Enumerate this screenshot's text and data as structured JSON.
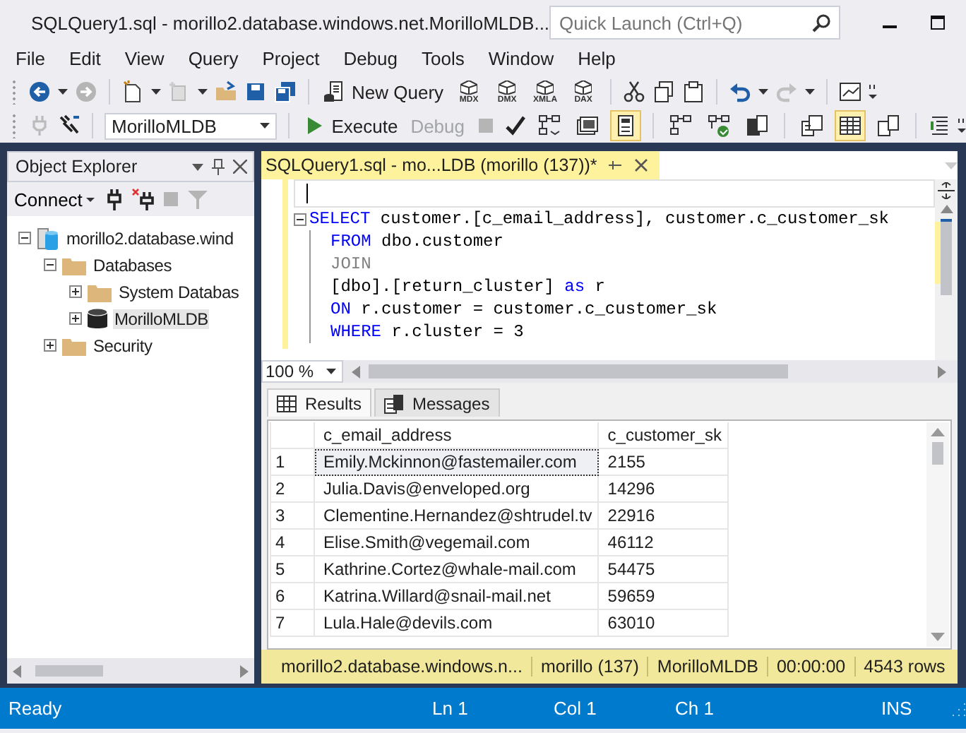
{
  "window": {
    "title": "SQLQuery1.sql - morillo2.database.windows.net.MorilloMLDB...",
    "quick_launch": {
      "placeholder": "Quick Launch (Ctrl+Q)"
    }
  },
  "menu": [
    "File",
    "Edit",
    "View",
    "Query",
    "Project",
    "Debug",
    "Tools",
    "Window",
    "Help"
  ],
  "toolbar_1": {
    "new_query": "New Query",
    "query_types": [
      "MDX",
      "DMX",
      "XMLA",
      "DAX"
    ]
  },
  "toolbar_2": {
    "database": "MorilloMLDB",
    "execute": "Execute",
    "debug": {
      "label": "Debug",
      "disabled": true
    },
    "toggles": [
      {
        "selected": false
      },
      {
        "selected": false
      },
      {
        "selected": true
      },
      {
        "selected": false
      },
      {
        "selected": false
      },
      {
        "selected": false
      },
      {
        "selected": false
      },
      {
        "selected": true
      },
      {
        "selected": false
      }
    ]
  },
  "object_explorer": {
    "title": "Object Explorer",
    "connect": "Connect",
    "tree": [
      {
        "label": "morillo2.database.wind",
        "kind": "server",
        "expanded": true,
        "selected": false,
        "children": [
          {
            "label": "Databases",
            "kind": "folder",
            "expanded": true,
            "selected": false,
            "children": [
              {
                "label": "System Databas",
                "kind": "folder",
                "expanded": false,
                "selected": false
              },
              {
                "label": "MorilloMLDB",
                "kind": "database",
                "expanded": false,
                "selected": true
              }
            ]
          },
          {
            "label": "Security",
            "kind": "folder",
            "expanded": false,
            "selected": false
          }
        ]
      }
    ]
  },
  "editor": {
    "tab": {
      "label": "SQLQuery1.sql - mo...LDB (morillo (137))*",
      "selected": true
    },
    "statement": {
      "expanded": true,
      "tokens": [
        {
          "kind": "keyword",
          "text": "SELECT"
        },
        {
          "kind": "plain",
          "text": " customer.[c_email_address], customer.c_customer_sk"
        }
      ],
      "children": [
        {
          "tokens": [
            {
              "kind": "keyword",
              "text": "FROM"
            },
            {
              "kind": "plain",
              "text": " dbo.customer"
            }
          ]
        },
        {
          "tokens": [
            {
              "kind": "operator",
              "text": "JOIN"
            }
          ]
        },
        {
          "tokens": [
            {
              "kind": "plain",
              "text": "[dbo].[return_cluster] "
            },
            {
              "kind": "keyword",
              "text": "as"
            },
            {
              "kind": "plain",
              "text": " r"
            }
          ]
        },
        {
          "tokens": [
            {
              "kind": "keyword",
              "text": "ON"
            },
            {
              "kind": "plain",
              "text": " r.customer = customer.c_customer_sk"
            }
          ]
        },
        {
          "tokens": [
            {
              "kind": "keyword",
              "text": "WHERE"
            },
            {
              "kind": "plain",
              "text": " r.cluster = 3"
            }
          ]
        }
      ]
    },
    "zoom": "100 %"
  },
  "results": {
    "tabs": [
      {
        "label": "Results",
        "selected": true
      },
      {
        "label": "Messages",
        "selected": false
      }
    ],
    "table": {
      "columns": [
        "c_email_address",
        "c_customer_sk"
      ],
      "rows": [
        {
          "number": "1",
          "cells": [
            "Emily.Mckinnon@fastemailer.com",
            "2155"
          ],
          "selected": true
        },
        {
          "number": "2",
          "cells": [
            "Julia.Davis@enveloped.org",
            "14296"
          ],
          "selected": false
        },
        {
          "number": "3",
          "cells": [
            "Clementine.Hernandez@shtrudel.tv",
            "22916"
          ],
          "selected": false
        },
        {
          "number": "4",
          "cells": [
            "Elise.Smith@vegemail.com",
            "46112"
          ],
          "selected": false
        },
        {
          "number": "5",
          "cells": [
            "Kathrine.Cortez@whale-mail.com",
            "54475"
          ],
          "selected": false
        },
        {
          "number": "6",
          "cells": [
            "Katrina.Willard@snail-mail.net",
            "59659"
          ],
          "selected": false
        },
        {
          "number": "7",
          "cells": [
            "Lula.Hale@devils.com",
            "63010"
          ],
          "selected": false
        }
      ]
    }
  },
  "query_status": {
    "server": "morillo2.database.windows.n...",
    "user": "morillo (137)",
    "database": "MorilloMLDB",
    "elapsed": "00:00:00",
    "rows": "4543 rows"
  },
  "status_bar": {
    "message": "Ready",
    "line": "Ln 1",
    "column": "Col 1",
    "char": "Ch 1",
    "mode": "INS"
  }
}
